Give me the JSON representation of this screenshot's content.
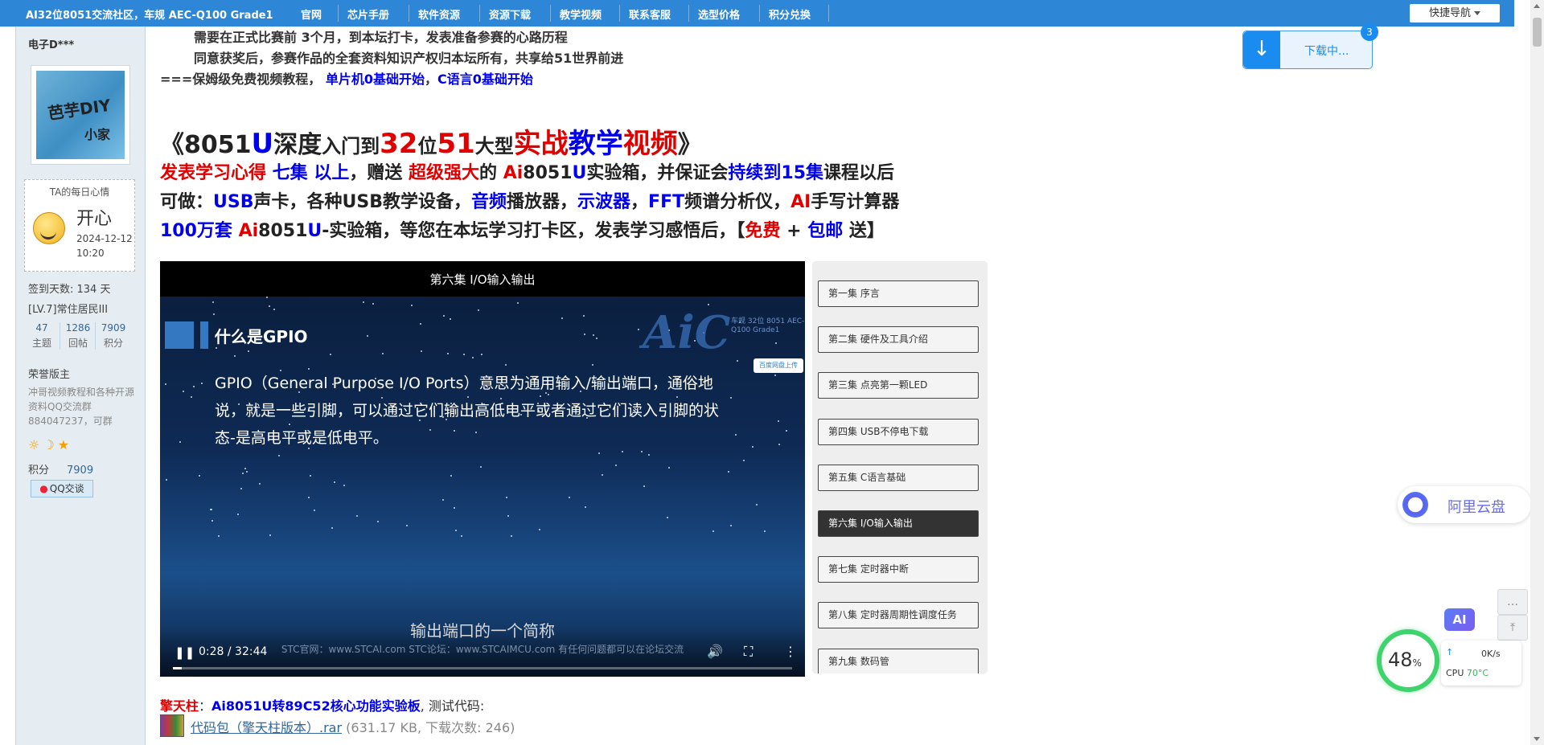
{
  "topnav": {
    "brand": "AI32位8051交流社区，车规 AEC-Q100 Grade1",
    "items": [
      "官网",
      "芯片手册",
      "软件资源",
      "资源下载",
      "教学视频",
      "联系客服",
      "选型价格",
      "积分兑换"
    ],
    "quick_nav": "快捷导航"
  },
  "profile": {
    "username": "电子D***",
    "avatar_text_1": "芭芋DIY",
    "avatar_text_2": "小家",
    "mood_title": "TA的每日心情",
    "mood_name": "开心",
    "mood_date": "2024-12-12 10:20",
    "signin_days": "签到天数: 134 天",
    "level": "[LV.7]常住居民III",
    "stats": [
      {
        "value": "47",
        "label": "主题"
      },
      {
        "value": "1286",
        "label": "回帖"
      },
      {
        "value": "7909",
        "label": "积分"
      }
    ],
    "honor": "荣誉版主",
    "desc": "冲哥视频教程和各种开源资料QQ交流群884047237，可群",
    "points_label": "积分",
    "points_value": "7909",
    "qq_button": "QQ交谈"
  },
  "post": {
    "line1": "需要在正式比赛前 3个月，到本坛打卡，发表准备参赛的心路历程",
    "line2": "同意获奖后，参赛作品的全套资料知识产权归本坛所有，共享给51世界前进",
    "line3_prefix": "===保姆级免费视频教程，",
    "line3_link1": "单片机0基础开始",
    "line3_link2": "C语言0基础开始",
    "title_parts": [
      "《8051",
      "U",
      "深度",
      "入门到",
      "32",
      "位",
      "51",
      "大型",
      "实战",
      "教学",
      "视频",
      "》"
    ],
    "promo1_parts": [
      "发表学习心得",
      " 七集 以上",
      "，赠送",
      " 超级强大",
      "的 ",
      "Ai",
      "8051",
      "U",
      "实验箱，并保证会",
      "持续到15集",
      "课程以后"
    ],
    "promo2_parts": [
      "可做：",
      "USB",
      "声卡，各种USB教学设备，",
      "音频",
      "播放器，",
      "示波器",
      "，",
      "FFT",
      "频谱分析仪，",
      "AI",
      "手写计算器"
    ],
    "promo3_parts": [
      "100万套 ",
      "Ai",
      "8051",
      "U",
      "-实验箱，等您在本坛学习打卡区，发表学习感悟后，【",
      "免费",
      " + ",
      "包邮",
      " 送】"
    ],
    "code_prefix": "擎天柱",
    "code_link": "Ai8051U转89C52核心功能实验板",
    "code_suffix": ", 测试代码:",
    "file_link": "代码包（擎天柱版本）.rar",
    "file_meta": "(631.17 KB, 下载次数: 246)"
  },
  "video": {
    "title": "第六集 I/O输入输出",
    "slide_heading": "什么是GPIO",
    "slide_text": "GPIO（General Purpose I/O Ports）意思为通用输入/输出端口，通俗地说，就是一些引脚，可以通过它们输出高低电平或者通过它们读入引脚的状态-是高电平或是低电平。",
    "logo": "AiC",
    "logo_small": "车规 32位 8051\nAEC-Q100 Grade1",
    "baidu_badge": "百度网盘上传",
    "subtitle": "输出端口的一个简称",
    "watermark": "STC官网：www.STCAI.com      STC论坛：www.STCAIMCU.com      有任何问题都可以在论坛交流",
    "time": "0:28 / 32:44",
    "progress_fraction": 0.014
  },
  "playlist": [
    "第一集 序言",
    "第二集 硬件及工具介绍",
    "第三集 点亮第一颗LED",
    "第四集 USB不停电下载",
    "第五集 C语言基础",
    "第六集 I/O输入输出",
    "第七集 定时器中断",
    "第八集 定时器周期性调度任务",
    "第九集 数码管"
  ],
  "active_episode": 5,
  "download_panel": {
    "label": "下载中...",
    "badge": "3"
  },
  "aliyun": {
    "label": "阿里云盘"
  },
  "ai_button": "AI",
  "perf": {
    "percent": "48",
    "percent_unit": "%",
    "speed": "0K/s",
    "cpu_label": "CPU",
    "cpu_temp": "70°C"
  }
}
